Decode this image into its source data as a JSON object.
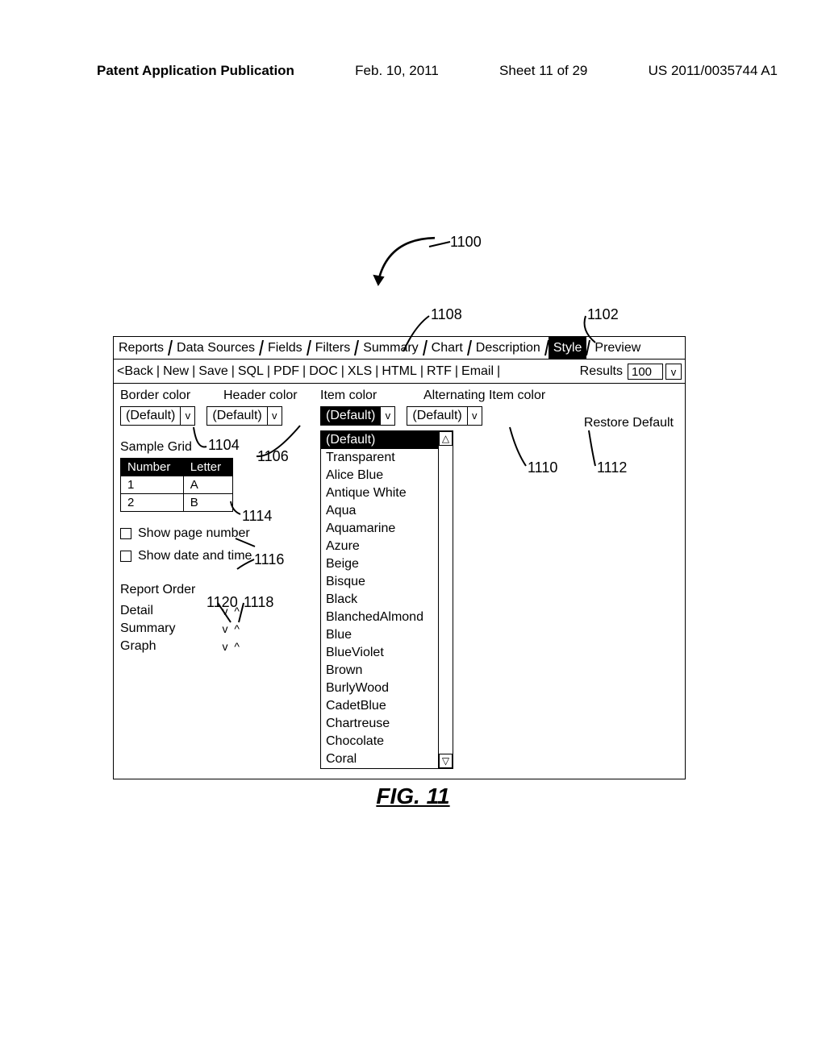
{
  "header": {
    "publication": "Patent Application Publication",
    "date": "Feb. 10, 2011",
    "sheet": "Sheet 11 of 29",
    "docnum": "US 2011/0035744 A1"
  },
  "callouts": {
    "c1100": "1100",
    "c1108": "1108",
    "c1102": "1102",
    "c1104": "1104",
    "c1106": "1106",
    "c1114": "1114",
    "c1116": "1116",
    "c1118": "1118",
    "c1120": "1120",
    "c1110": "1110",
    "c1112": "1112"
  },
  "tabs": [
    "Reports",
    "Data Sources",
    "Fields",
    "Filters",
    "Summary",
    "Chart",
    "Description",
    "Style",
    "Preview"
  ],
  "active_tab": "Style",
  "actions": [
    "<Back",
    "New",
    "Save",
    "SQL",
    "PDF",
    "DOC",
    "XLS",
    "HTML",
    "RTF",
    "Email"
  ],
  "results_label": "Results",
  "results_value": "100",
  "v": "v",
  "labels": {
    "border": "Border color",
    "header": "Header color",
    "item": "Item color",
    "alt": "Alternating Item color",
    "restore": "Restore Default",
    "sample": "Sample Grid",
    "show_page": "Show page number",
    "show_date": "Show date and time",
    "order": "Report Order"
  },
  "default_text": "(Default)",
  "grid": {
    "headers": [
      "Number",
      "Letter"
    ],
    "rows": [
      [
        "1",
        "A"
      ],
      [
        "2",
        "B"
      ]
    ]
  },
  "order_items": [
    "Detail",
    "Summary",
    "Graph"
  ],
  "order_ctrl": "v ^",
  "color_options": [
    "(Default)",
    "Transparent",
    "Alice Blue",
    "Antique White",
    "Aqua",
    "Aquamarine",
    "Azure",
    "Beige",
    "Bisque",
    "Black",
    "BlanchedAlmond",
    "Blue",
    "BlueViolet",
    "Brown",
    "BurlyWood",
    "CadetBlue",
    "Chartreuse",
    "Chocolate",
    "Coral"
  ],
  "figcaption": "FIG. 11"
}
